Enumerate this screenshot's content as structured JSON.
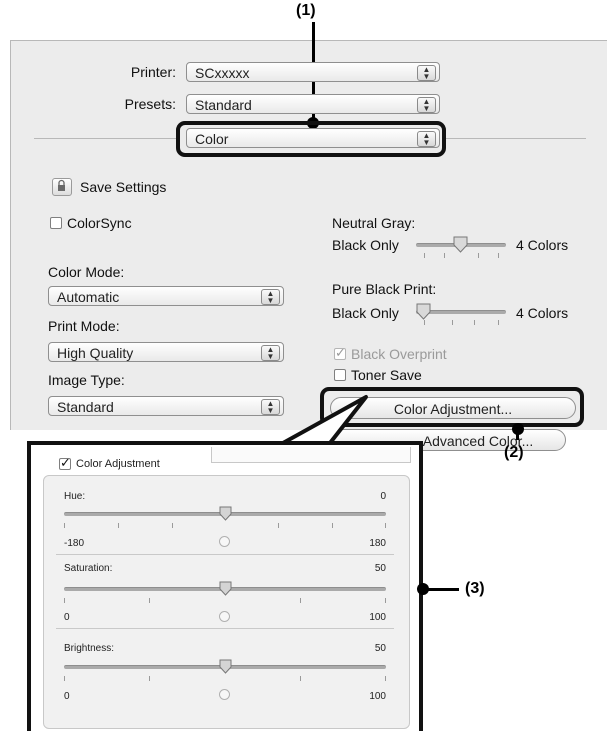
{
  "callouts": {
    "c1": "(1)",
    "c2": "(2)",
    "c3": "(3)"
  },
  "dialog": {
    "printer_label": "Printer:",
    "printer_value": "SCxxxxx",
    "presets_label": "Presets:",
    "presets_value": "Standard",
    "panel_value": "Color",
    "save_settings": "Save Settings",
    "colorsync": "ColorSync",
    "color_mode_label": "Color Mode:",
    "color_mode_value": "Automatic",
    "print_mode_label": "Print Mode:",
    "print_mode_value": "High Quality",
    "image_type_label": "Image Type:",
    "image_type_value": "Standard",
    "neutral_gray_label": "Neutral Gray:",
    "neutral_gray_left": "Black Only",
    "neutral_gray_right": "4 Colors",
    "pure_black_label": "Pure Black Print:",
    "pure_black_left": "Black Only",
    "pure_black_right": "4 Colors",
    "black_overprint": "Black Overprint",
    "black_overprint_checked": true,
    "toner_save": "Toner Save",
    "color_adjustment_button": "Color Adjustment...",
    "advanced_color_button": "Advanced Color..."
  },
  "zoom_panel": {
    "checkbox_label": "Color Adjustment",
    "checked": true,
    "sliders": [
      {
        "label": "Hue:",
        "value": "0",
        "min": "-180",
        "max": "180",
        "level": 0.5
      },
      {
        "label": "Saturation:",
        "value": "50",
        "min": "0",
        "max": "100",
        "level": 0.5
      },
      {
        "label": "Brightness:",
        "value": "50",
        "min": "0",
        "max": "100",
        "level": 0.5
      }
    ]
  }
}
